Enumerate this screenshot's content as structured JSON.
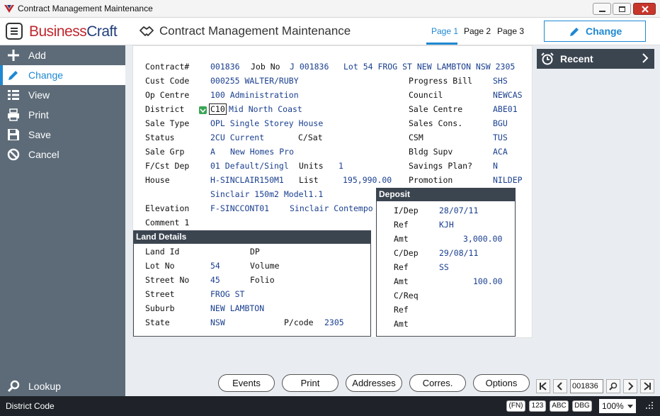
{
  "window": {
    "title": "Contract Management Maintenance"
  },
  "header": {
    "logo_part1": "Business",
    "logo_part2": "Craft",
    "title": "Contract Management Maintenance",
    "tabs": [
      "Page 1",
      "Page 2",
      "Page 3"
    ],
    "active_tab": "Page 1",
    "mode_button": "Change"
  },
  "sidebar": {
    "items": [
      {
        "label": "Add",
        "icon": "plus-icon"
      },
      {
        "label": "Change",
        "icon": "pencil-icon"
      },
      {
        "label": "View",
        "icon": "list-icon"
      },
      {
        "label": "Print",
        "icon": "printer-icon"
      },
      {
        "label": "Save",
        "icon": "floppy-icon"
      },
      {
        "label": "Cancel",
        "icon": "cancel-icon"
      }
    ],
    "active": "Change",
    "lookup": "Lookup"
  },
  "recent": {
    "label": "Recent"
  },
  "form": {
    "contract_label": "Contract#",
    "contract": "001836",
    "jobno_label": "Job No",
    "jobno": "J 001836",
    "address": "Lot 54 FROG ST NEW LAMBTON NSW 2305",
    "custcode_label": "Cust Code",
    "custcode": "000255 WALTER/RUBY",
    "opcentre_label": "Op Centre",
    "opcentre": "100 Administration",
    "district_label": "District",
    "district_code": "C10",
    "district_name": "Mid North Coast",
    "saletype_label": "Sale Type",
    "saletype": "OPL Single Storey House",
    "status_label": "Status",
    "status": "2CU Current",
    "csat_label": "C/Sat",
    "salegrp_label": "Sale Grp",
    "salegrp": "A",
    "salegrp_name": "New Homes Pro",
    "fcstdep_label": "F/Cst Dep",
    "fcstdep": "01 Default/Singl",
    "units_label": "Units",
    "units": "1",
    "house_label": "House",
    "house": "H-SINCLAIR150M1",
    "list_label": "List",
    "list": "195,990.00",
    "house_desc": "Sinclair 150m2 Model1.1",
    "elevation_label": "Elevation",
    "elevation": "F-SINCCONT01",
    "elevation_name": "Sinclair Contempo",
    "comment_label": "Comment 1",
    "progressbill_label": "Progress Bill",
    "progressbill": "SHS",
    "council_label": "Council",
    "council": "NEWCAS",
    "salecentre_label": "Sale Centre",
    "salecentre": "ABE01",
    "salescons_label": "Sales Cons.",
    "salescons": "BGU",
    "csm_label": "CSM",
    "csm": "TUS",
    "bldgsupv_label": "Bldg Supv",
    "bldgsupv": "ACA",
    "savings_label": "Savings Plan?",
    "savings": "N",
    "promotion_label": "Promotion",
    "promotion": "NILDEP"
  },
  "land": {
    "heading": "Land Details",
    "landid_label": "Land Id",
    "dp_label": "DP",
    "lotno_label": "Lot No",
    "lotno": "54",
    "volume_label": "Volume",
    "streetno_label": "Street No",
    "streetno": "45",
    "folio_label": "Folio",
    "street_label": "Street",
    "street": "FROG ST",
    "suburb_label": "Suburb",
    "suburb": "NEW LAMBTON",
    "state_label": "State",
    "state": "NSW",
    "pcode_label": "P/code",
    "pcode": "2305"
  },
  "deposit": {
    "heading": "Deposit",
    "idep_label": "I/Dep",
    "idep": "28/07/11",
    "ref1_label": "Ref",
    "ref1": "KJH",
    "amt1_label": "Amt",
    "amt1": "3,000.00",
    "cdep_label": "C/Dep",
    "cdep": "29/08/11",
    "ref2_label": "Ref",
    "ref2": "SS",
    "amt2_label": "Amt",
    "amt2": "100.00",
    "creq_label": "C/Req",
    "ref3_label": "Ref",
    "amt3_label": "Amt"
  },
  "actions": [
    "Events",
    "Print",
    "Addresses",
    "Corres.",
    "Options"
  ],
  "navigator": {
    "record": "001836"
  },
  "status": {
    "message": "District Code",
    "badges": [
      "(FN)",
      "123",
      "ABC",
      "DBG"
    ],
    "zoom": "100%"
  },
  "colors": {
    "accent": "#1e88d2",
    "sidebar": "#5d6b78",
    "header_dark": "#3b4550",
    "value_text": "#1a3f8f"
  }
}
